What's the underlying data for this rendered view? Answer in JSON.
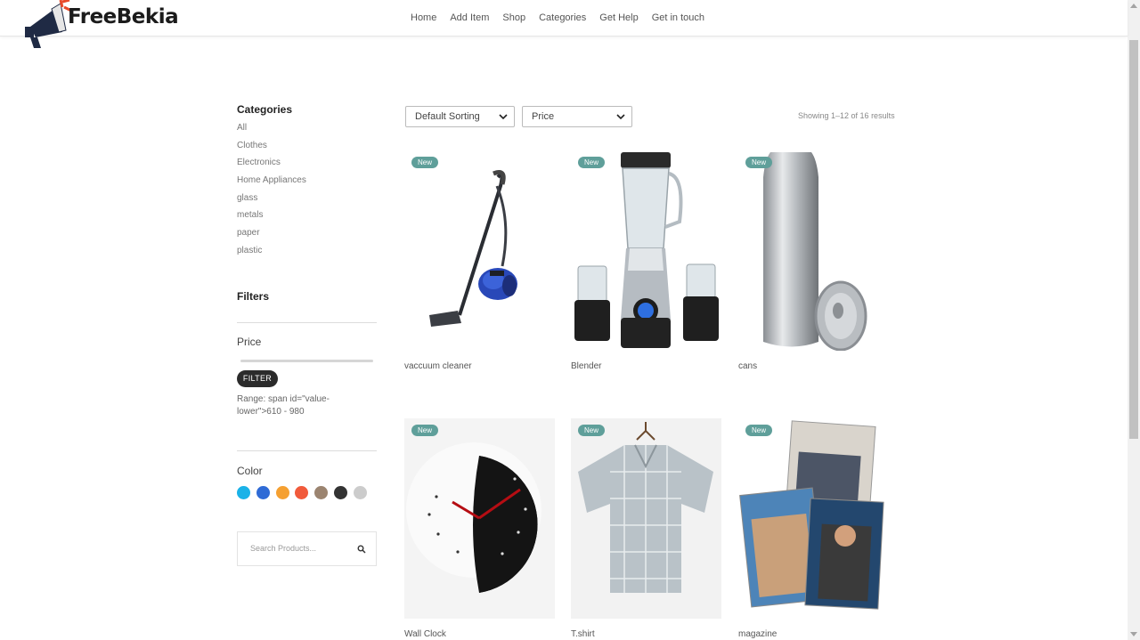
{
  "header": {
    "logo_text": "FreeBekia",
    "nav": [
      {
        "label": "Home"
      },
      {
        "label": "Add Item"
      },
      {
        "label": "Shop"
      },
      {
        "label": "Categories"
      },
      {
        "label": "Get Help"
      },
      {
        "label": "Get in touch"
      }
    ]
  },
  "sidebar": {
    "categories_heading": "Categories",
    "categories": [
      "All",
      "Clothes",
      "Electronics",
      "Home Appliances",
      "glass",
      "metals",
      "paper",
      "plastic"
    ],
    "filters_heading": "Filters",
    "price_label": "Price",
    "filter_button": "FILTER",
    "range_text": "Range: span id=\"value-lower\">610 - 980",
    "color_label": "Color",
    "colors": [
      "#1ab2e8",
      "#2f6bd6",
      "#f5a031",
      "#f15a3b",
      "#9b8470",
      "#333333",
      "#cccccc"
    ],
    "search_placeholder": "Search Products...",
    "search_icon": "search-icon"
  },
  "toolbar": {
    "sorting_selected": "Default Sorting",
    "price_selected": "Price",
    "result_count": "Showing 1–12 of 16 results"
  },
  "products": [
    {
      "name": "vaccuum cleaner",
      "badge": "New"
    },
    {
      "name": "Blender",
      "badge": "New"
    },
    {
      "name": "cans",
      "badge": "New"
    },
    {
      "name": "Wall Clock",
      "badge": "New"
    },
    {
      "name": "T.shirt",
      "badge": "New"
    },
    {
      "name": "magazine",
      "badge": "New"
    }
  ]
}
